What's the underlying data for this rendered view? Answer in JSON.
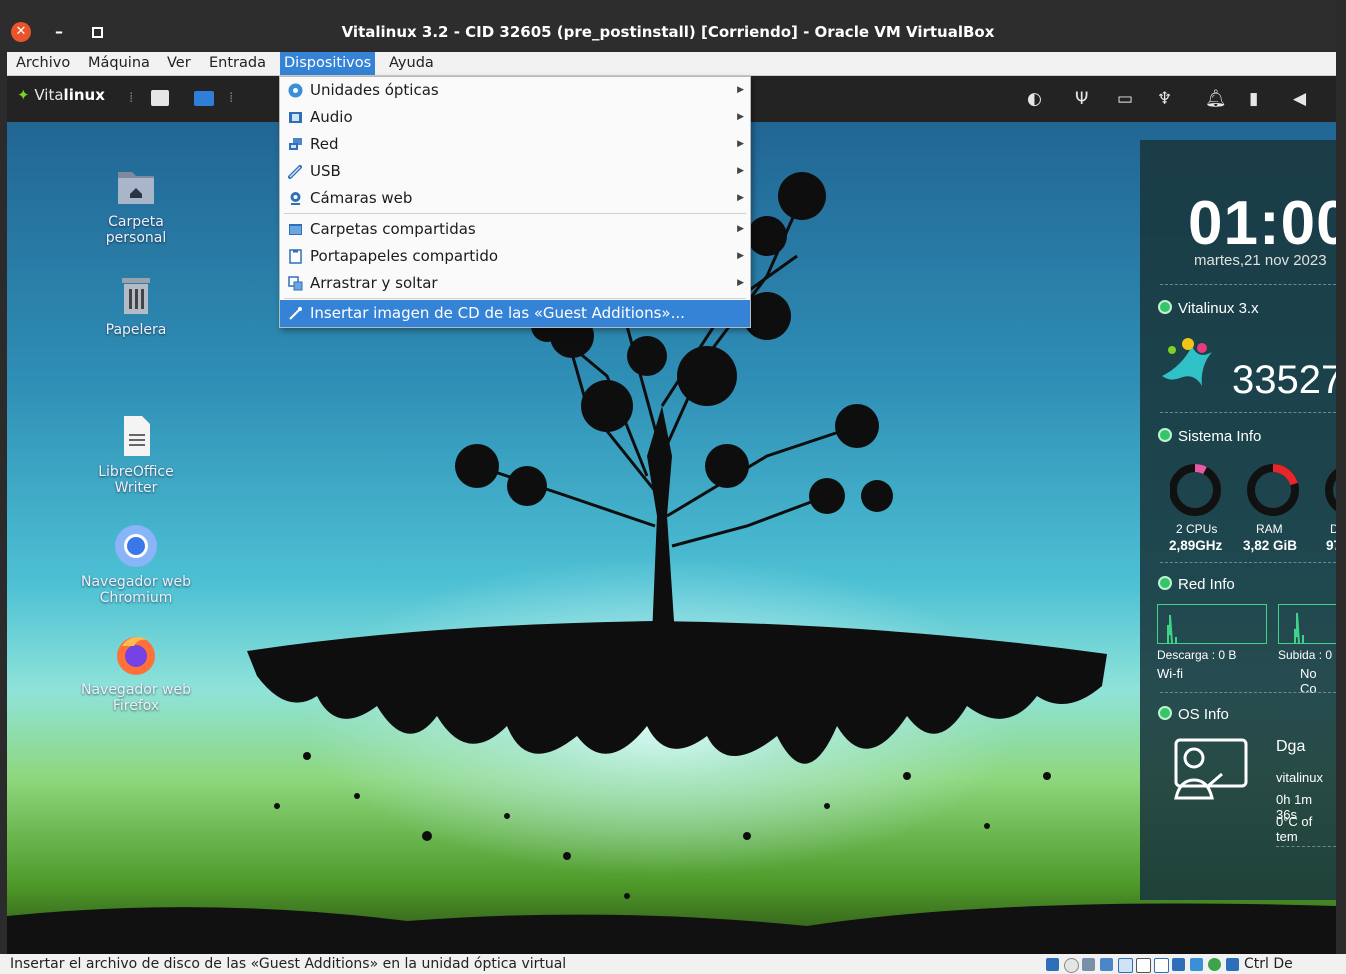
{
  "window": {
    "title": "Vitalinux 3.2 - CID 32605 (pre_postinstall) [Corriendo] - Oracle VM VirtualBox",
    "close_glyph": "✕",
    "minimize_glyph": "–"
  },
  "menubar": {
    "items": [
      "Archivo",
      "Máquina",
      "Ver",
      "Entrada",
      "Dispositivos",
      "Ayuda"
    ],
    "active": "Dispositivos"
  },
  "guest_panel": {
    "logo_prefix": "Vita",
    "logo_brand": "linux"
  },
  "desktop_icons": [
    {
      "label": "Carpeta personal",
      "icon": "home-folder-icon"
    },
    {
      "label": "Papelera",
      "icon": "trash-icon"
    },
    {
      "label": "LibreOffice\nWriter",
      "icon": "writer-document-icon"
    },
    {
      "label": "Navegador web\nChromium",
      "icon": "chromium-icon"
    },
    {
      "label": "Navegador web\nFirefox",
      "icon": "firefox-icon"
    }
  ],
  "conky": {
    "time": "01:00",
    "date": "martes,21 nov 2023",
    "distro_header": "Vitalinux 3.x",
    "cid": "33527",
    "system_header": "Sistema Info",
    "cpu_label": "2 CPUs",
    "cpu_value": "2,89GHz",
    "ram_label": "RAM",
    "ram_value": "3,82 GiB",
    "disk_label": "D",
    "disk_value": "97",
    "net_header": "Red Info",
    "download": "Descarga : 0 B",
    "upload": "Subida : 0",
    "wifi": "Wi-fi",
    "no_conn": "No Co",
    "os_header": "OS Info",
    "os_user": "Dga",
    "os_host": "vitalinux",
    "uptime": "0h 1m 36s",
    "temp": "0°C of tem"
  },
  "devices_menu": {
    "items": [
      {
        "label": "Unidades ópticas",
        "submenu": true,
        "icon": "optical-disc-icon"
      },
      {
        "label": "Audio",
        "submenu": true,
        "icon": "audio-icon"
      },
      {
        "label": "Red",
        "submenu": true,
        "icon": "network-icon"
      },
      {
        "label": "USB",
        "submenu": true,
        "icon": "usb-icon"
      },
      {
        "label": "Cámaras web",
        "submenu": true,
        "icon": "webcam-icon"
      },
      {
        "label": "Carpetas compartidas",
        "submenu": true,
        "icon": "shared-folder-icon"
      },
      {
        "label": "Portapapeles compartido",
        "submenu": true,
        "icon": "clipboard-icon"
      },
      {
        "label": "Arrastrar y soltar",
        "submenu": true,
        "icon": "drag-drop-icon"
      },
      {
        "label": "Insertar imagen de CD de las «Guest Additions»...",
        "submenu": false,
        "icon": "guest-additions-icon",
        "highlighted": true
      }
    ],
    "submenu_arrow": "▶"
  },
  "statusbar": {
    "message": "Insertar el archivo de disco de las «Guest Additions» en la unidad óptica virtual",
    "host_key": "Ctrl De"
  },
  "colors": {
    "menu_highlight": "#3583d6",
    "titlebar": "#2d2d2d",
    "close_button": "#e9542b",
    "conky_accent": "#36c46a",
    "ram_ring": "#e8262a",
    "cpu_ring": "#e85aa0"
  }
}
